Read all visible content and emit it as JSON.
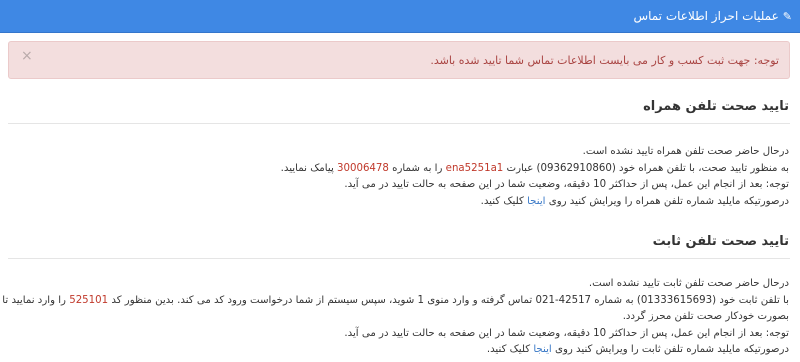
{
  "header": {
    "title": "عملیات احراز اطلاعات تماس"
  },
  "alert": {
    "text": "توجه: جهت ثبت کسب و کار می بایست اطلاعات تماس شما تایید شده باشد.",
    "close_symbol": "×"
  },
  "mobile": {
    "title": "تایید صحت تلفن همراه",
    "status": "درحال حاضر صحت تلفن همراه تایید نشده است.",
    "l2_a": "به منظور تایید صحت، با تلفن همراه خود (09362910860) عبارت ",
    "l2_code": "ena5251a1",
    "l2_b": " را به شماره ",
    "l2_number": "30006478",
    "l2_c": " پیامک نمایید.",
    "note": "توجه: بعد از انجام این عمل، پس از حداکثر 10 دقیقه، وضعیت شما در این صفحه به حالت تایید در می آید.",
    "l4_a": "درصورتیکه مایلید شماره تلفن همراه را ویرایش کنید روی ",
    "l4_link": "اینجا",
    "l4_b": " کلیک کنید."
  },
  "landline": {
    "title": "تایید صحت تلفن ثابت",
    "status": "درحال حاضر صحت تلفن ثابت تایید نشده است.",
    "l2_a": "با تلفن ثابت خود (01333615693) به شماره 42517-021 تماس گرفته و وارد منوی 1 شوید، سپس سیستم از شما درخواست ورود کد می کند. بدین منظور کد ",
    "l2_code": "525101",
    "l2_b": " را وارد نمایید تا",
    "l3": "بصورت خودکار صحت تلفن محرز گردد.",
    "note": "توجه: بعد از انجام این عمل، پس از حداکثر 10 دقیقه، وضعیت شما در این صفحه به حالت تایید در می آید.",
    "l5_a": "درصورتیکه مایلید شماره تلفن ثابت را ویرایش کنید روی ",
    "l5_link": "اینجا",
    "l5_b": " کلیک کنید."
  }
}
